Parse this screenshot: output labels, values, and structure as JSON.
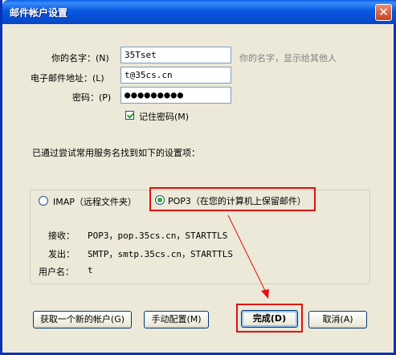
{
  "window": {
    "title": "邮件帐户设置",
    "close_glyph": "✕"
  },
  "form": {
    "name_label": "你的名字：(N)",
    "name_value": "35Tset",
    "name_hint": "你的名字，显示给其他人",
    "email_label": "电子邮件地址：(L)",
    "email_value": "t@35cs.cn",
    "password_label": "密码：(P)",
    "password_value": "●●●●●●●●●",
    "remember_label": "记住密码(M)",
    "remember_checked": true
  },
  "status_text": "已通过尝试常用服务名找到如下的设置项：",
  "options": {
    "imap_label": "IMAP（远程文件夹）",
    "pop3_label": "POP3（在您的计算机上保留邮件）",
    "selected": "pop3"
  },
  "details": {
    "incoming_label": "接收：",
    "incoming_value": "POP3，pop.35cs.cn，STARTTLS",
    "outgoing_label": "发出：",
    "outgoing_value": "SMTP，smtp.35cs.cn，STARTTLS",
    "username_label": "用户名：",
    "username_value": "t"
  },
  "buttons": {
    "new_account": "获取一个新的帐户(G)",
    "manual": "手动配置(M)",
    "done": "完成(D)",
    "cancel": "取消(A)"
  },
  "colors": {
    "highlight": "#e01010",
    "titlebar": "#0858e0"
  }
}
